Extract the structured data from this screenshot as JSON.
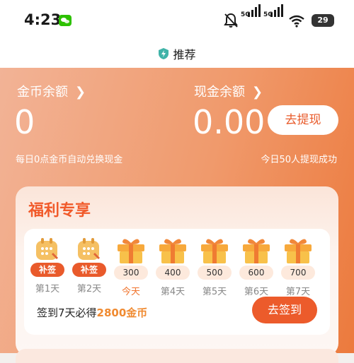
{
  "status_bar": {
    "time": "4:23",
    "network_1": "5G",
    "network_2": "5G",
    "battery": "29",
    "icons": [
      "wechat-icon",
      "mute-icon",
      "signal-icon",
      "wifi-icon",
      "battery-icon"
    ]
  },
  "header": {
    "title": "推荐",
    "icon": "shield-icon"
  },
  "balance": {
    "coin_label": "金币余额",
    "coin_value": "0",
    "cash_label": "现金余额",
    "cash_value": "0.00",
    "withdraw_button": "去提现",
    "note_left": "每日0点金币自动兑换现金",
    "note_right": "今日50人提现成功"
  },
  "welfare": {
    "title": "福利专享",
    "days": [
      {
        "badge": "补签",
        "label": "第1天",
        "type": "makeup"
      },
      {
        "badge": "补签",
        "label": "第2天",
        "type": "makeup"
      },
      {
        "badge": "300",
        "label": "今天",
        "type": "gift"
      },
      {
        "badge": "400",
        "label": "第4天",
        "type": "gift"
      },
      {
        "badge": "500",
        "label": "第5天",
        "type": "gift"
      },
      {
        "badge": "600",
        "label": "第6天",
        "type": "gift"
      },
      {
        "badge": "700",
        "label": "第7天",
        "type": "gift"
      }
    ],
    "sign_prefix": "签到7天必得",
    "sign_highlight": "2800金币",
    "sign_button": "去签到"
  },
  "colors": {
    "accent": "#ec5b2b",
    "highlight": "#f08a30",
    "hero_start": "#f2b396",
    "hero_end": "#ec7a3d"
  }
}
